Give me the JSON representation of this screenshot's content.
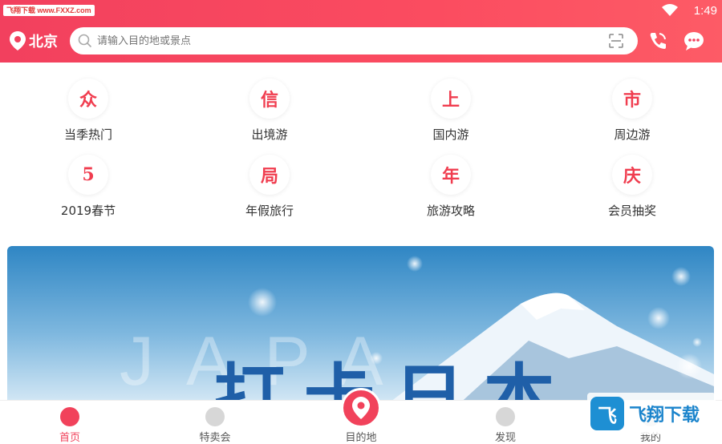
{
  "status_bar": {
    "watermark": "飞翔下载 www.FXXZ.com",
    "time": "1:49",
    "icons": [
      "wifi-icon",
      "battery-icon"
    ]
  },
  "header": {
    "city": "北京",
    "search_placeholder": "请输入目的地或景点",
    "icons": [
      "location-pin-icon",
      "search-icon",
      "scan-icon",
      "phone-icon",
      "chat-icon"
    ]
  },
  "categories": [
    {
      "glyph": "众",
      "label": "当季热门"
    },
    {
      "glyph": "信",
      "label": "出境游"
    },
    {
      "glyph": "上",
      "label": "国内游"
    },
    {
      "glyph": "市",
      "label": "周边游"
    },
    {
      "glyph": "5",
      "label": "2019春节"
    },
    {
      "glyph": "局",
      "label": "年假旅行"
    },
    {
      "glyph": "年",
      "label": "旅游攻略"
    },
    {
      "glyph": "庆",
      "label": "会员抽奖"
    }
  ],
  "banner": {
    "headline": "打卡日本",
    "bg_letters": "JAPA"
  },
  "tabbar": {
    "items": [
      {
        "label": "首页",
        "icon": "home-icon",
        "active": true
      },
      {
        "label": "特卖会",
        "icon": "shirt-icon",
        "active": false
      },
      {
        "label": "目的地",
        "icon": "destination-pin-icon",
        "active": false
      },
      {
        "label": "发现",
        "icon": "discover-icon",
        "active": false
      },
      {
        "label": "我的",
        "icon": "profile-icon",
        "active": false
      }
    ]
  },
  "watermark_logo": {
    "text": "飞翔下载",
    "mark": "飞"
  },
  "colors": {
    "accent": "#f1425b",
    "banner_text": "#1f5fa8"
  }
}
